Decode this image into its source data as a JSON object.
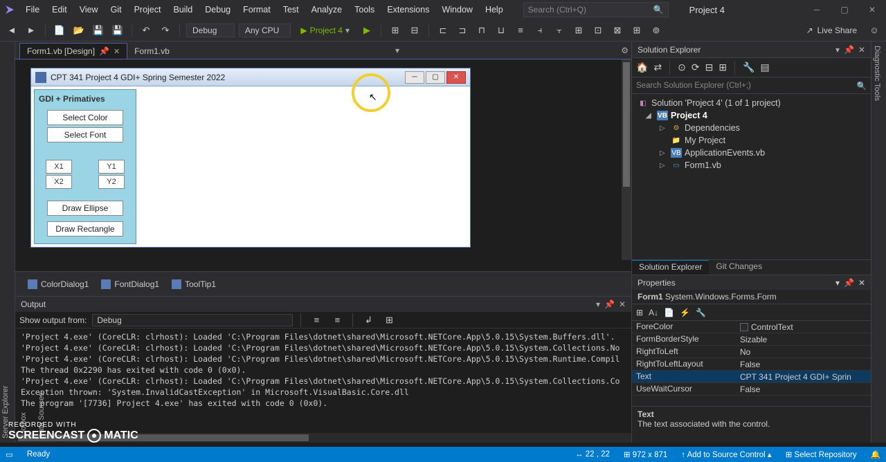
{
  "menus": [
    "File",
    "Edit",
    "View",
    "Git",
    "Project",
    "Build",
    "Debug",
    "Format",
    "Test",
    "Analyze",
    "Tools",
    "Extensions",
    "Window",
    "Help"
  ],
  "search_placeholder": "Search (Ctrl+Q)",
  "project_title": "Project 4",
  "toolbar": {
    "config": "Debug",
    "platform": "Any CPU",
    "start": "Project 4",
    "liveshare": "Live Share"
  },
  "tabs": {
    "active": "Form1.vb [Design]",
    "inactive": "Form1.vb"
  },
  "winform": {
    "title": "CPT 341 Project 4 GDI+ Spring Semester 2022",
    "panel_title": "GDI + Primatives",
    "btn_color": "Select Color",
    "btn_font": "Select Font",
    "x1": "X1",
    "y1": "Y1",
    "x2": "X2",
    "y2": "Y2",
    "btn_ellipse": "Draw Ellipse",
    "btn_rect": "Draw Rectangle"
  },
  "components": [
    "ColorDialog1",
    "FontDialog1",
    "ToolTip1"
  ],
  "output": {
    "title": "Output",
    "show_from": "Show output from:",
    "source": "Debug",
    "lines": [
      "'Project 4.exe' (CoreCLR: clrhost): Loaded 'C:\\Program Files\\dotnet\\shared\\Microsoft.NETCore.App\\5.0.15\\System.Buffers.dll'.",
      "'Project 4.exe' (CoreCLR: clrhost): Loaded 'C:\\Program Files\\dotnet\\shared\\Microsoft.NETCore.App\\5.0.15\\System.Collections.No",
      "'Project 4.exe' (CoreCLR: clrhost): Loaded 'C:\\Program Files\\dotnet\\shared\\Microsoft.NETCore.App\\5.0.15\\System.Runtime.Compil",
      "The thread 0x2290 has exited with code 0 (0x0).",
      "'Project 4.exe' (CoreCLR: clrhost): Loaded 'C:\\Program Files\\dotnet\\shared\\Microsoft.NETCore.App\\5.0.15\\System.Collections.Co",
      "Exception thrown: 'System.InvalidCastException' in Microsoft.VisualBasic.Core.dll",
      "The program '[7736] Project 4.exe' has exited with code 0 (0x0)."
    ]
  },
  "solution": {
    "title": "Solution Explorer",
    "search": "Search Solution Explorer (Ctrl+;)",
    "sln": "Solution 'Project 4' (1 of 1 project)",
    "proj": "Project 4",
    "deps": "Dependencies",
    "myproj": "My Project",
    "appevents": "ApplicationEvents.vb",
    "form1": "Form1.vb",
    "tabs": [
      "Solution Explorer",
      "Git Changes"
    ]
  },
  "properties": {
    "title": "Properties",
    "object_name": "Form1",
    "object_type": "System.Windows.Forms.Form",
    "rows": [
      {
        "name": "ForeColor",
        "val": "ControlText",
        "color": true
      },
      {
        "name": "FormBorderStyle",
        "val": "Sizable"
      },
      {
        "name": "RightToLeft",
        "val": "No"
      },
      {
        "name": "RightToLeftLayout",
        "val": "False"
      },
      {
        "name": "Text",
        "val": "CPT 341 Project 4 GDI+ Sprin",
        "hl": true
      },
      {
        "name": "UseWaitCursor",
        "val": "False"
      }
    ],
    "desc_name": "Text",
    "desc_text": "The text associated with the control."
  },
  "status": {
    "ready": "Ready",
    "pos": "22 , 22",
    "size": "972 x 871",
    "add_source": "Add to Source Control",
    "sel_repo": "Select Repository"
  },
  "recorder": {
    "rec": "RECORDED WITH",
    "brand1": "SCREENCAST",
    "brand2": "MATIC"
  },
  "rails": {
    "left": [
      "Server Explorer",
      "Toolbox",
      "Data Sources"
    ],
    "right": "Diagnostic Tools"
  }
}
